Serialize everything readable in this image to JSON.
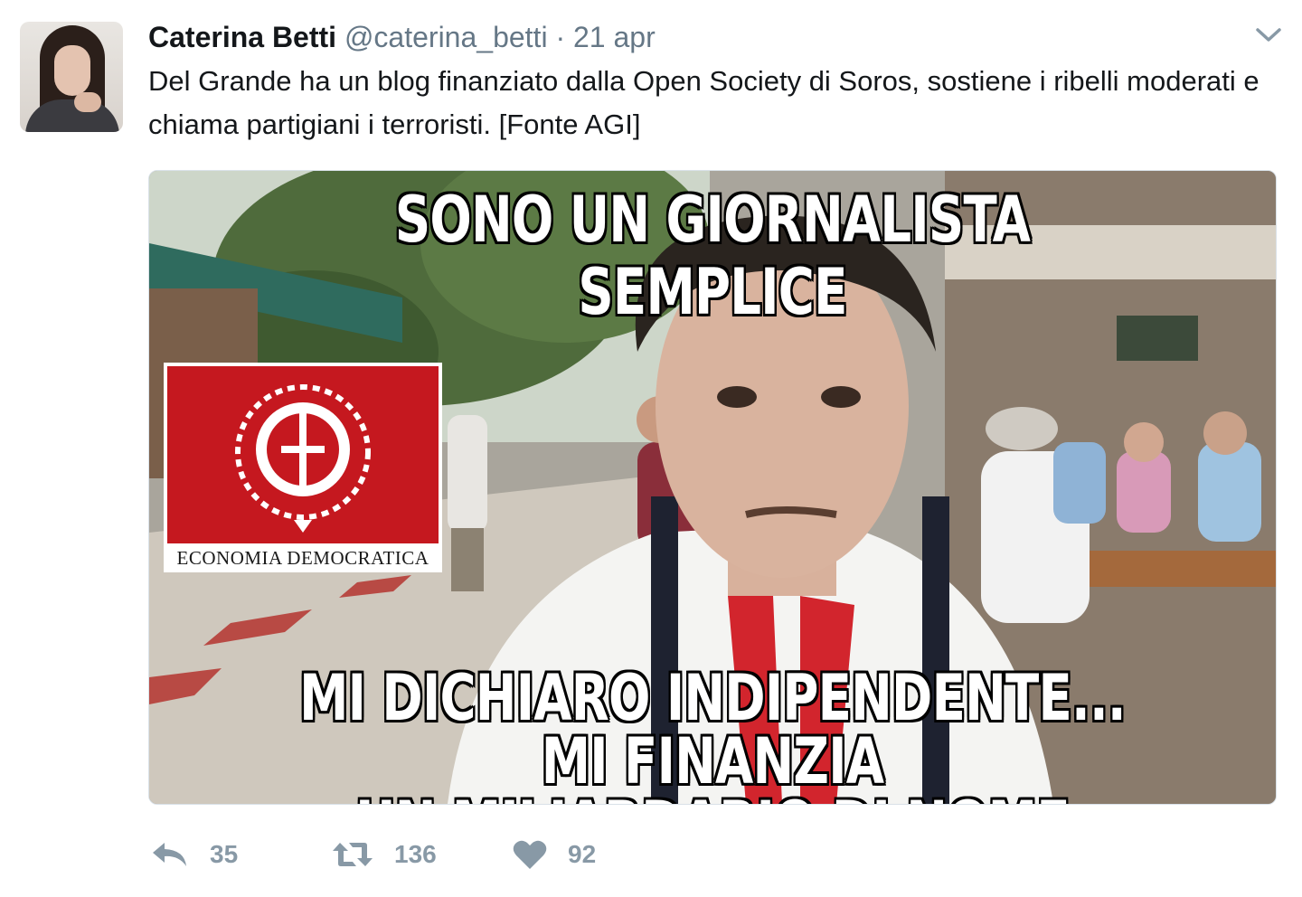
{
  "tweet": {
    "author_name": "Caterina Betti",
    "handle": "@caterina_betti",
    "separator": "·",
    "date": "21 apr",
    "text": "Del Grande ha un blog finanziato dalla Open Society di Soros, sostiene i ribelli moderati e chiama partigiani i terroristi. [Fonte AGI]"
  },
  "media": {
    "top_caption": "SONO UN GIORNALISTA SEMPLICE",
    "bottom_caption_line1": "MI DICHIARO INDIPENDENTE... MI FINANZIA",
    "bottom_caption_line2": "UN MILIARDARIO DI NOME SOROS",
    "logo_label": "ECONOMIA DEMOCRATICA"
  },
  "actions": {
    "reply_count": "35",
    "retweet_count": "136",
    "like_count": "92"
  },
  "icons": {
    "menu": "chevron-down-icon",
    "reply": "reply-icon",
    "retweet": "retweet-icon",
    "like": "heart-icon"
  },
  "colors": {
    "name": "#14171a",
    "meta": "#657786",
    "action": "#8899a6",
    "logo_red": "#c5181f"
  }
}
